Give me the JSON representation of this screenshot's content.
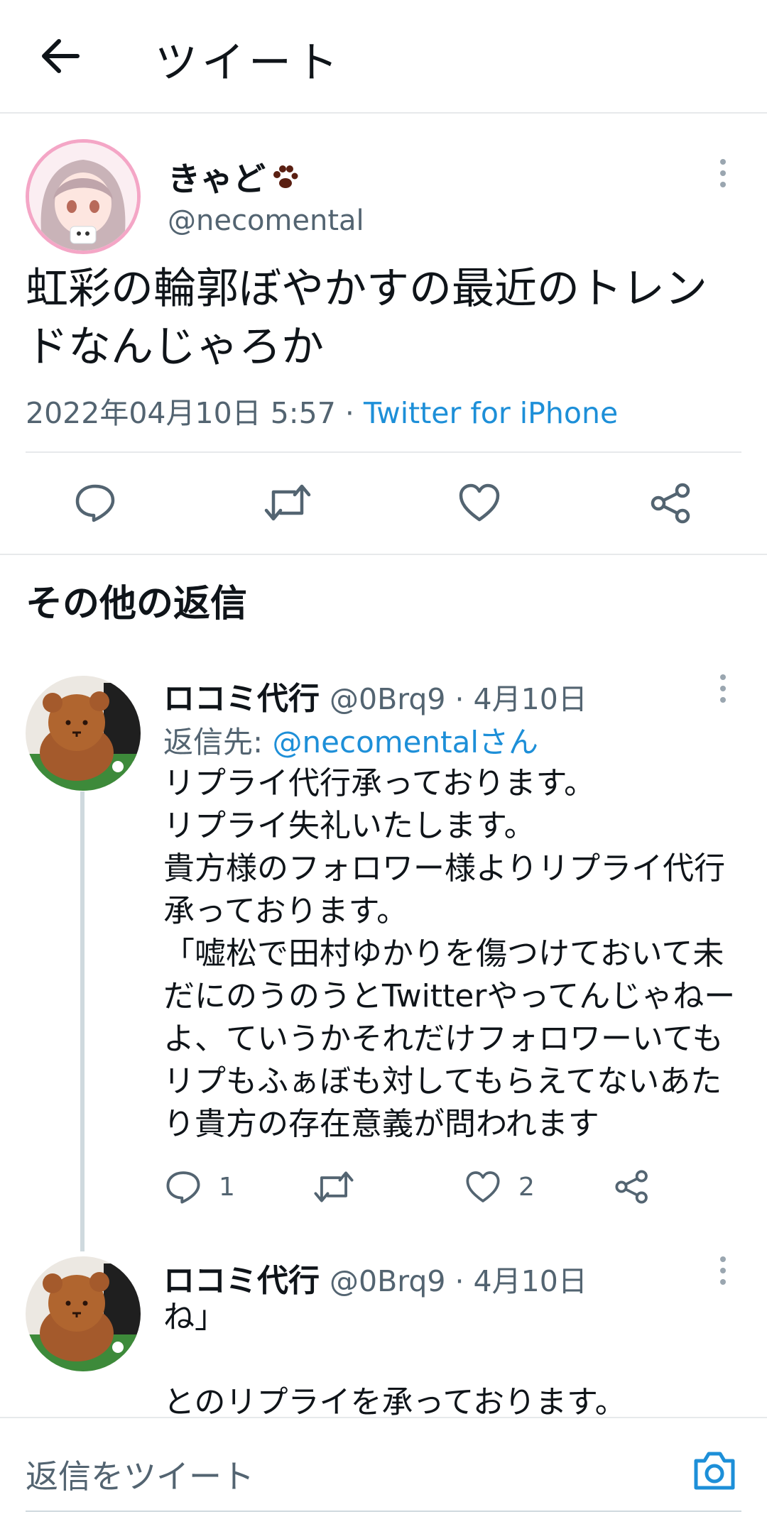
{
  "header": {
    "title": "ツイート"
  },
  "main_tweet": {
    "display_name": "きゃど",
    "handle": "@necomental",
    "text": "虹彩の輪郭ぼやかすの最近のトレンドなんじゃろか",
    "timestamp": "2022年04月10日 5:57",
    "separator": "·",
    "source": "Twitter for iPhone"
  },
  "section": {
    "title": "その他の返信"
  },
  "replies": [
    {
      "display_name": "ロコミ代行",
      "handle_date": "@0Brq9 · 4月10日",
      "reply_to_prefix": "返信先:",
      "reply_to_mention": "@necomentalさん",
      "text": "リプライ代行承っております。\nリプライ失礼いたします。\n貴方様のフォロワー様よりリプライ代行承っております。\n「嘘松で田村ゆかりを傷つけておいて未だにのうのうとTwitterやってんじゃねーよ、ていうかそれだけフォロワーいてもリプもふぁぼも対してもらえてないあたり貴方の存在意義が問われます",
      "reply_count": "1",
      "like_count": "2"
    },
    {
      "display_name": "ロコミ代行",
      "handle_date": "@0Brq9 · 4月10日",
      "text": "ね」\n\nとのリプライを承っております。"
    }
  ],
  "compose": {
    "placeholder": "返信をツイート"
  },
  "icons": {
    "back": "arrow-left-icon",
    "reply": "reply-icon",
    "retweet": "retweet-icon",
    "like": "heart-icon",
    "share": "share-icon",
    "more": "more-vertical-icon",
    "camera": "camera-icon"
  },
  "colors": {
    "link": "#1d8fd8",
    "secondary_text": "#536471",
    "divider": "#e7e9eb"
  }
}
